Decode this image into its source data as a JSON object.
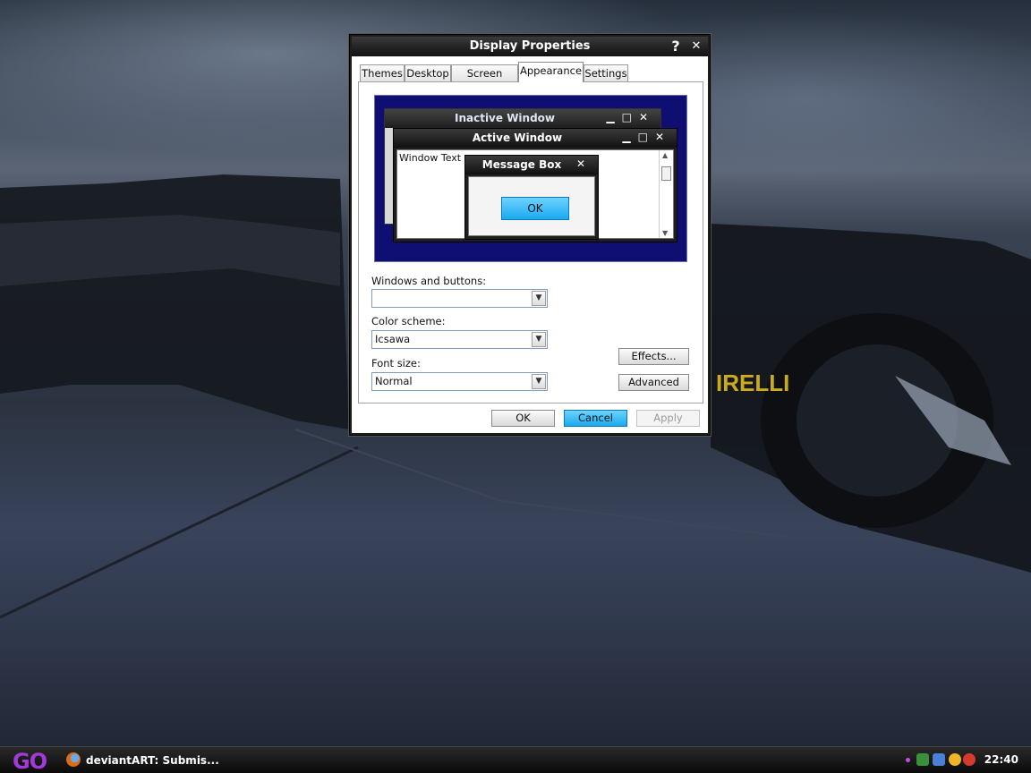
{
  "dialog": {
    "title": "Display Properties",
    "help": "?",
    "close": "✕",
    "tabs": [
      "Themes",
      "Desktop",
      "Screen Saver",
      "Appearance",
      "Settings"
    ],
    "active_tab": "Appearance",
    "preview": {
      "inactive_title": "Inactive Window",
      "active_title": "Active Window",
      "window_text": "Window Text",
      "message_box_title": "Message Box",
      "ok_label": "OK",
      "minimize": "▁",
      "maximize": "□",
      "close": "✕"
    },
    "windows_buttons_label": "Windows and buttons:",
    "windows_buttons_value": "",
    "color_scheme_label": "Color scheme:",
    "color_scheme_value": "Icsawa",
    "font_size_label": "Font size:",
    "font_size_value": "Normal",
    "effects_label": "Effects...",
    "advanced_label": "Advanced",
    "ok_label": "OK",
    "cancel_label": "Cancel",
    "apply_label": "Apply"
  },
  "taskbar": {
    "start_label": "GO",
    "task_label": "deviantART: Submis...",
    "task_icon": "firefox-icon",
    "clock": "22:40"
  },
  "colors": {
    "accent": "#19a9ef",
    "preview_background": "#0f0f73",
    "start": "#a23ad9"
  }
}
